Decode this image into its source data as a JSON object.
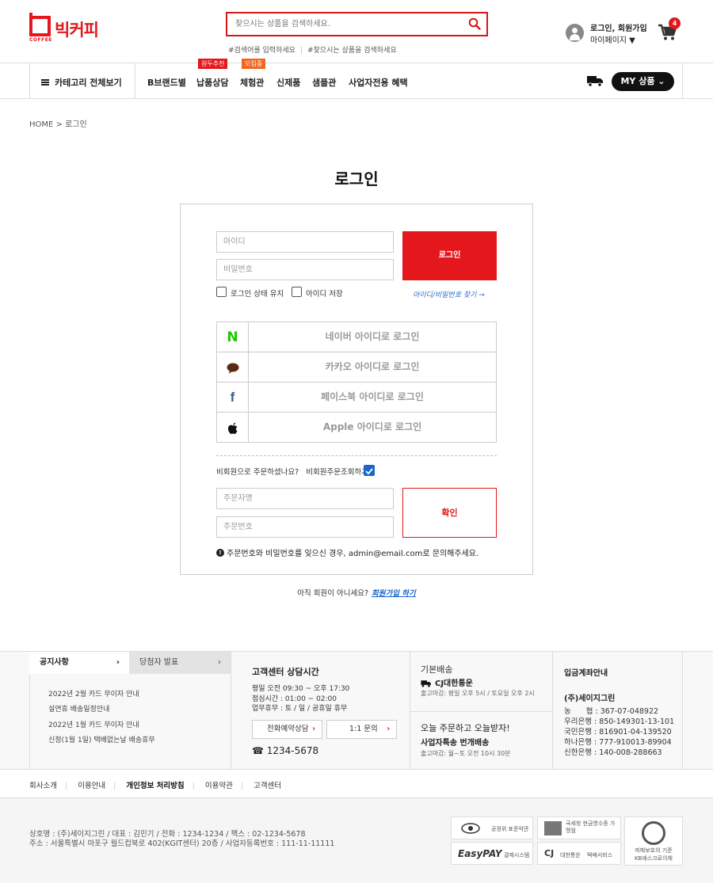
{
  "header": {
    "logo_text": "빅커피",
    "logo_sub": "COFFEE",
    "search_placeholder": "찾으시는 상품을 검색하세요.",
    "hashtags": [
      "#검색어를 입력하세요",
      "#찾으시는 상품을 검색하세요"
    ],
    "login_link": "로그인, 회원가입",
    "mypage_link": "마이페이지 ▼",
    "cart_count": "4"
  },
  "nav": {
    "category_all": "카테고리 전체보기",
    "items": [
      {
        "label": "B브랜드별"
      },
      {
        "label": "납품상담",
        "tag": "원두추천"
      },
      {
        "label": "체험관",
        "tag": "모집중"
      },
      {
        "label": "신제품"
      },
      {
        "label": "샘플관"
      },
      {
        "label": "사업자전용 혜택"
      }
    ],
    "my_button": "MY 상품"
  },
  "breadcrumb": {
    "home": "HOME",
    "current": "로그인"
  },
  "page_title": "로그인",
  "login_form": {
    "id_placeholder": "아이디",
    "pw_placeholder": "비밀번호",
    "login_button": "로그인",
    "keep_login": "로그인 상태 유지",
    "save_id": "아이디 저장",
    "find_link": "아이디/비밀번호 찾기 →"
  },
  "social": [
    {
      "icon": "naver-icon",
      "label": "네이버 아이디로 로그인"
    },
    {
      "icon": "kakao-icon",
      "label": "카카오 아이디로 로그인"
    },
    {
      "icon": "facebook-icon",
      "label": "페이스북 아이디로 로그인"
    },
    {
      "icon": "apple-icon",
      "label": "Apple 아이디로 로그인"
    }
  ],
  "guest": {
    "question": "비회원으로 주문하셨나요?",
    "check_label": "비회원주문조회하기",
    "name_placeholder": "주문자명",
    "order_placeholder": "주문번호",
    "confirm_button": "확인",
    "notice": "주문번호와 비밀번호를 잊으신 경우, admin@email.com로 문의해주세요."
  },
  "signup": {
    "question": "아직 회원이 아니세요?",
    "link": "회원가입 하기"
  },
  "footer": {
    "tab_notice": "공지사항",
    "tab_winner": "당첨자 발표",
    "notices": [
      "2022년 2월 카드 무이자 안내",
      "설연휴 배송일정안내",
      "2022년 1월 카드 무이자 안내",
      "신정(1월 1일) 택배없는날 배송휴무"
    ],
    "cs_title": "고객센터 상담시간",
    "cs_hours": [
      "평일 오전 09:30 ~ 오후 17:30",
      "점심시간 : 01:00 ~ 02:00",
      "업무휴무 : 토 / 일 / 공휴일 휴무"
    ],
    "cs_btn_call": "전화예약상담",
    "cs_btn_inquiry": "1:1 문의",
    "cs_phone": "☎ 1234-5678",
    "ship_title": "기본배송",
    "ship_company": "CJ대한통운",
    "ship_deadline": "출고마감: 평일 오후 5시 / 토요일 오후 2시",
    "ship_today": "오늘 주문하고 오늘받자!",
    "ship_biz": "사업자특송 번개배송",
    "ship_biz_deadline": "출고마감: 월~토 오전 10시 30분",
    "bank_title": "입금계좌안내",
    "bank_company": "(주)세이지그린",
    "banks": [
      "농　　협 : 367-07-048922",
      "우리은행 : 850-149301-13-101",
      "국민은행 : 816901-04-139520",
      "하나은행 : 777-910013-89904",
      "신한은행 : 140-008-288663"
    ],
    "links": [
      "회사소개",
      "이용안내",
      "개인정보 처리방침",
      "이용약관",
      "고객센터"
    ],
    "company_line1": "상호명 : (주)세이지그린 / 대표 : 김민기 / 전화 : 1234-1234 / 팩스 : 02-1234-5678",
    "company_line2": "주소 : 서울특별시 마포구 월드컵북로 402(KGIT센터) 20층 / 사업자등록번호 : 111-11-11111",
    "certs": {
      "ftc": "공정위 표준약관",
      "nts": "국세청 현금영수증 가맹점",
      "easypay": "EasyPAY",
      "easypay_sub": "결제시스템",
      "cj": "대한통운",
      "cj_sub": "택배서비스",
      "escrow_line1": "피해보호의 기준",
      "escrow_line2": "KB에스크로이체"
    }
  }
}
